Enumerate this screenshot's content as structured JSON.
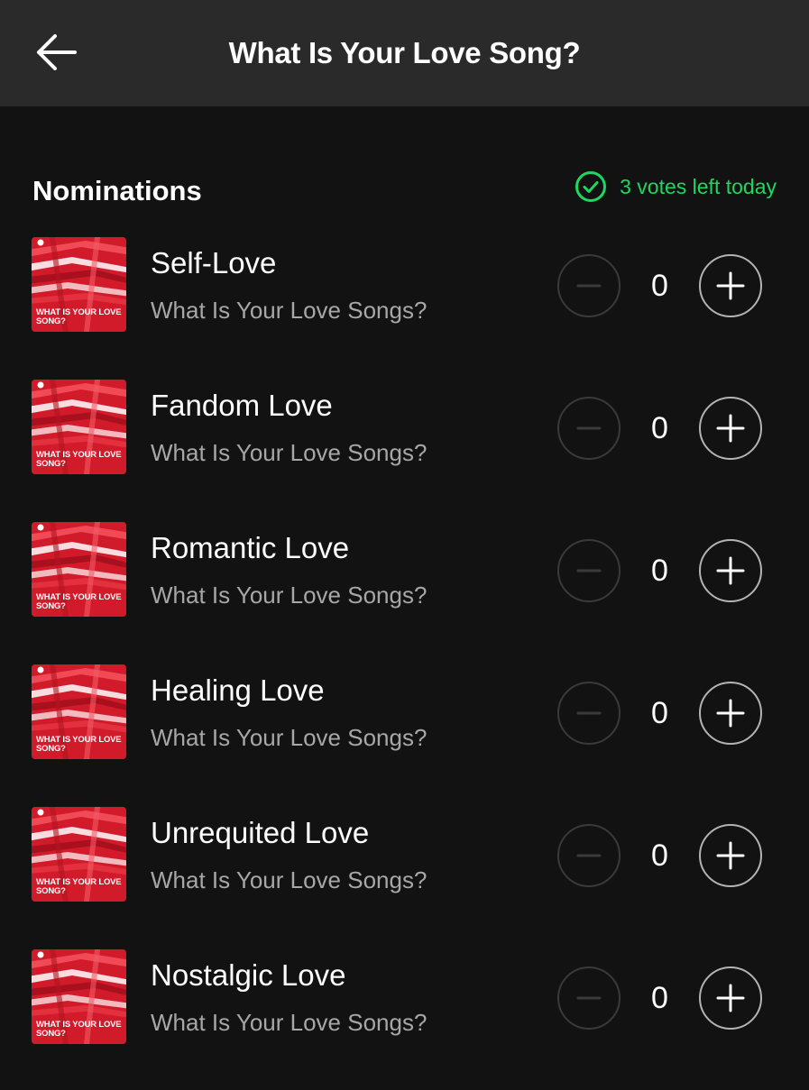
{
  "header": {
    "title": "What Is Your Love Song?",
    "back_icon": "arrow-left-icon"
  },
  "section": {
    "title": "Nominations"
  },
  "votes": {
    "text": "3 votes left today",
    "icon": "check-circle-icon",
    "color": "#1ed760"
  },
  "cover": {
    "text": "WHAT IS YOUR LOVE SONG?",
    "color": "#d11a2a"
  },
  "nominations": [
    {
      "title": "Self-Love",
      "subtitle": "What Is Your Love Songs?",
      "count": "0"
    },
    {
      "title": "Fandom Love",
      "subtitle": "What Is Your Love Songs?",
      "count": "0"
    },
    {
      "title": "Romantic Love",
      "subtitle": "What Is Your Love Songs?",
      "count": "0"
    },
    {
      "title": "Healing Love",
      "subtitle": "What Is Your Love Songs?",
      "count": "0"
    },
    {
      "title": "Unrequited Love",
      "subtitle": "What Is Your Love Songs?",
      "count": "0"
    },
    {
      "title": "Nostalgic Love",
      "subtitle": "What Is Your Love Songs?",
      "count": "0"
    }
  ]
}
